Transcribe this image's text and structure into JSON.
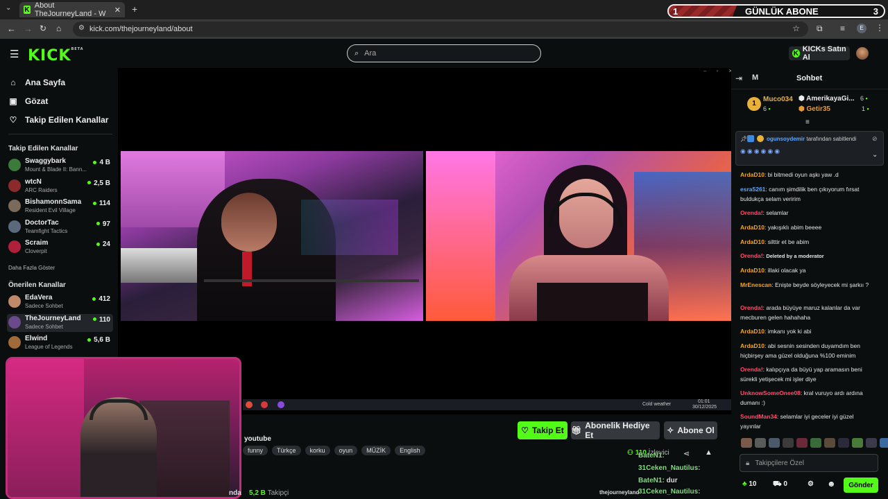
{
  "browser": {
    "tab_title": "About TheJourneyLand - W",
    "url": "kick.com/thejourneyland/about",
    "profile_letter": "E"
  },
  "sub_widget": {
    "left": "1",
    "label": "GÜNLÜK ABONE",
    "right": "3"
  },
  "header": {
    "logo": "KICK",
    "logo_beta": "BETA",
    "search_placeholder": "Ara",
    "buy_kicks": "KICKs Satın Al"
  },
  "sidebar": {
    "nav": [
      {
        "label": "Ana Sayfa",
        "icon": "home-icon"
      },
      {
        "label": "Gözat",
        "icon": "browse-icon"
      },
      {
        "label": "Takip Edilen Kanallar",
        "icon": "heart-icon"
      }
    ],
    "followed_title": "Takip Edilen Kanallar",
    "followed": [
      {
        "name": "Swaggybark",
        "game": "Mount & Blade II: Bann...",
        "viewers": "4 B",
        "color": "#3a7a3a"
      },
      {
        "name": "wtcN",
        "game": "ARC Raiders",
        "viewers": "2,5 B",
        "color": "#8a2a2a"
      },
      {
        "name": "BishamonnSama",
        "game": "Resident Evil Village",
        "viewers": "114",
        "color": "#7a6a5a"
      },
      {
        "name": "DoctorTac",
        "game": "Teamfight Tactics",
        "viewers": "97",
        "color": "#5a6a7a"
      },
      {
        "name": "Scraim",
        "game": "Cloverpit",
        "viewers": "24",
        "color": "#b0203a"
      }
    ],
    "show_more": "Daha Fazla Göster",
    "recommended_title": "Önerilen Kanallar",
    "recommended": [
      {
        "name": "EdaVera",
        "game": "Sadece Sohbet",
        "viewers": "412",
        "color": "#c08a6a"
      },
      {
        "name": "TheJourneyLand",
        "game": "Sadece Sohbet",
        "viewers": "110",
        "color": "#6a4a8a"
      },
      {
        "name": "Elwind",
        "game": "League of Legends",
        "viewers": "5,6 B",
        "color": "#a06a3a"
      }
    ]
  },
  "player": {
    "taskbar_weather": "Cold weather",
    "taskbar_time": "01:01",
    "taskbar_date": "30/12/2025"
  },
  "stream": {
    "title_fragment": "youtube",
    "tags": [
      "funny",
      "Türkçe",
      "korku",
      "oyun",
      "MÜZİK",
      "English"
    ],
    "follow_btn": "Takip Et",
    "gift_btn": "Abonelik Hediye Et",
    "sub_btn": "Abone Ol",
    "viewers": "110",
    "viewers_label": "İzleyici",
    "streamer_fragment": "nda",
    "followers": "5,2 B",
    "followers_label": "Takipçi",
    "handle": "thejourneyland"
  },
  "overlay_chat": [
    {
      "name": "BateN1:",
      "text": ""
    },
    {
      "name": "31Ceken_Nautilus:",
      "text": ""
    },
    {
      "name": "BateN1:",
      "text": "dur"
    },
    {
      "name": "31Ceken_Nautilus:",
      "text": ""
    }
  ],
  "chat": {
    "mode_letter": "M",
    "title": "Sohbet",
    "leaderboard": [
      {
        "rank": "1",
        "name": "Muco034",
        "count": "6"
      },
      {
        "name": "AmerikayaGi...",
        "count": "6"
      },
      {
        "name": "Getir35",
        "count": "1"
      }
    ],
    "pinned_by": "ogunsoydemir",
    "pinned_label": "tarafından sabitlendi",
    "messages": [
      {
        "user": "ArdaD10",
        "color": "#f5a623",
        "text": "bi bitmedi oyun aşkı yaw .d"
      },
      {
        "user": "esra5261",
        "color": "#5aa7ff",
        "text": "canım şimdilik ben çıkıyorum fırsat buldukça selam veririm"
      },
      {
        "user": "Orenda!",
        "color": "#ff4d6d",
        "text": "selamlar"
      },
      {
        "user": "ArdaD10",
        "color": "#f5a623",
        "text": "yakışıklı abim beeee"
      },
      {
        "user": "ArdaD10",
        "color": "#f5a623",
        "text": "silttir et be abim"
      },
      {
        "user": "Orenda!",
        "color": "#ff4d6d",
        "text": "Deleted by a moderator"
      },
      {
        "user": "ArdaD10",
        "color": "#f5a623",
        "text": "illaki olacak ya"
      },
      {
        "user": "MrEnescan",
        "color": "#f5a623",
        "text": "Enişte beyde söyleyecek mi şarkıı ?"
      },
      {
        "user": "Orenda!",
        "color": "#ff4d6d",
        "text": "arada büyüye maruz kalanlar da var mecburen gelen hahahaha"
      },
      {
        "user": "ArdaD10",
        "color": "#f5a623",
        "text": "imkanı yok ki abi"
      },
      {
        "user": "ArdaD10",
        "color": "#f5a623",
        "text": "abi sesnin sesinden duyamdım ben hiçbirşey ama güzel olduğuna %100 eminim"
      },
      {
        "user": "Orenda!",
        "color": "#ff4d6d",
        "text": "kalıpçıya da büyü yap aramasın beni sürekli yetişecek mi işler diye"
      },
      {
        "user": "UnknowSomeOnee08",
        "color": "#ff4d6d",
        "text": "kral vuruyo ardı ardına dumanı :)"
      },
      {
        "user": "SoundMan34",
        "color": "#ff4d6d",
        "text": "selamlar iyi geceler iyi güzel yayınlar"
      }
    ],
    "input_placeholder": "Takipçilere Özel",
    "kicks_count": "10",
    "gift_count": "0",
    "send_btn": "Gönder"
  },
  "colors": {
    "accent": "#53fc18",
    "bg": "#0b0e0f"
  }
}
